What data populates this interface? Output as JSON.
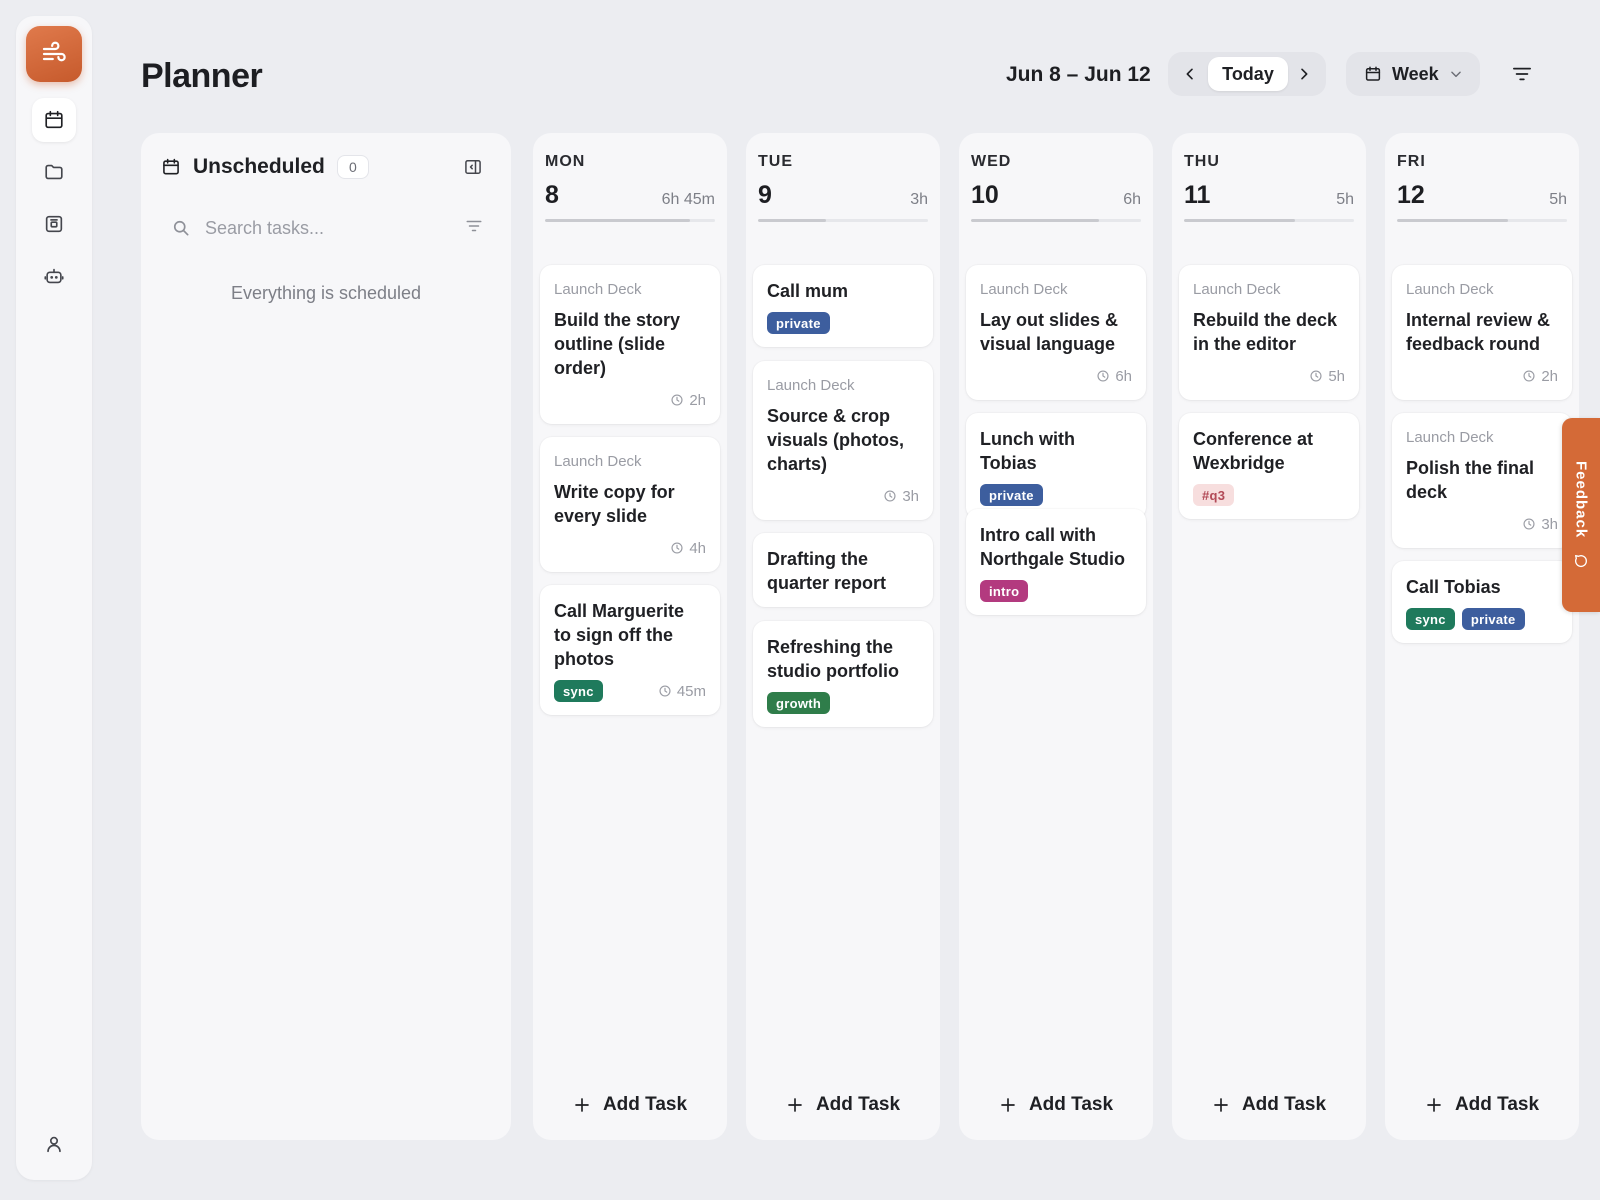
{
  "header": {
    "title": "Planner",
    "date_range": "Jun 8 – Jun 12",
    "today_label": "Today",
    "view_label": "Week"
  },
  "sidebar": {
    "items": [
      {
        "icon": "calendar-icon",
        "active": true
      },
      {
        "icon": "folder-icon",
        "active": false
      },
      {
        "icon": "archive-box-icon",
        "active": false
      },
      {
        "icon": "robot-icon",
        "active": false
      }
    ],
    "bottom_icon": "user-icon"
  },
  "unscheduled": {
    "title": "Unscheduled",
    "count": "0",
    "search_placeholder": "Search tasks...",
    "empty_message": "Everything is scheduled"
  },
  "add_task_label": "Add Task",
  "feedback_label": "Feedback",
  "colors": {
    "accent": "#d46a37",
    "tag_private": "#3d5e9e",
    "tag_sync": "#1f7a5c",
    "tag_growth": "#2f7d4a",
    "tag_intro": "#b33a7f",
    "tag_q3_bg": "#f7dede",
    "tag_q3_text": "#b24a57"
  },
  "days": [
    {
      "name": "MON",
      "num": "8",
      "hours": "6h 45m",
      "load": 0.85,
      "cards": [
        {
          "project": "Launch Deck",
          "title": "Build the story outline (slide order)",
          "tags": [],
          "duration": "2h"
        },
        {
          "project": "Launch Deck",
          "title": "Write copy for every slide",
          "tags": [],
          "duration": "4h"
        },
        {
          "project": "",
          "title": "Call Marguerite to sign off the photos",
          "tags": [
            "sync"
          ],
          "duration": "45m"
        }
      ]
    },
    {
      "name": "TUE",
      "num": "9",
      "hours": "3h",
      "load": 0.4,
      "cards": [
        {
          "project": "",
          "title": "Call mum",
          "tags": [
            "private"
          ],
          "duration": ""
        },
        {
          "project": "Launch Deck",
          "title": "Source & crop visuals (photos, charts)",
          "tags": [],
          "duration": "3h"
        },
        {
          "project": "",
          "title": "Drafting the quarter report",
          "tags": [],
          "duration": ""
        },
        {
          "project": "",
          "title": "Refreshing the studio portfolio",
          "tags": [
            "growth"
          ],
          "duration": ""
        }
      ]
    },
    {
      "name": "WED",
      "num": "10",
      "hours": "6h",
      "load": 0.75,
      "cards": [
        {
          "project": "Launch Deck",
          "title": "Lay out slides & visual language",
          "tags": [],
          "duration": "6h"
        },
        {
          "project": "",
          "title": "Lunch with Tobias",
          "tags": [
            "private"
          ],
          "duration": ""
        },
        {
          "project": "",
          "title": "Intro call with Northgale Studio",
          "tags": [
            "intro"
          ],
          "duration": ""
        }
      ]
    },
    {
      "name": "THU",
      "num": "11",
      "hours": "5h",
      "load": 0.65,
      "cards": [
        {
          "project": "Launch Deck",
          "title": "Rebuild the deck in the editor",
          "tags": [],
          "duration": "5h"
        },
        {
          "project": "",
          "title": "Conference at Wexbridge",
          "tags": [
            "#q3"
          ],
          "duration": ""
        }
      ]
    },
    {
      "name": "FRI",
      "num": "12",
      "hours": "5h",
      "load": 0.65,
      "cards": [
        {
          "project": "Launch Deck",
          "title": "Internal review & feedback round",
          "tags": [],
          "duration": "2h"
        },
        {
          "project": "Launch Deck",
          "title": "Polish the final deck",
          "tags": [],
          "duration": "3h"
        },
        {
          "project": "",
          "title": "Call Tobias",
          "tags": [
            "sync",
            "private"
          ],
          "duration": ""
        }
      ]
    }
  ]
}
